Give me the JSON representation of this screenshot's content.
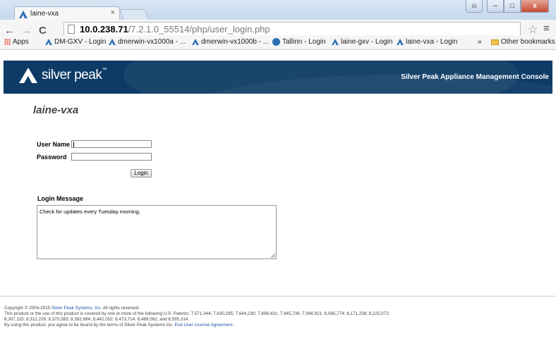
{
  "browser": {
    "tab_title": "laine-vxa",
    "tab_close": "×",
    "url_host": "10.0.238.71",
    "url_path": "/7.2.1.0_55514/php/user_login.php",
    "window_buttons": {
      "user": "⍝",
      "minimize": "–",
      "maximize": "□",
      "close": "x"
    },
    "nav": {
      "back": "←",
      "forward": "→",
      "reload": "C"
    },
    "star": "☆",
    "menu": "≡",
    "bookmarks": [
      {
        "label": "Apps",
        "icon": "apps-grid-icon"
      },
      {
        "label": "DM-GXV - Login",
        "icon": "silverpeak-icon"
      },
      {
        "label": "dmerwin-vx1000a - ...",
        "icon": "silverpeak-icon"
      },
      {
        "label": "dmerwin-vx1000b - ...",
        "icon": "silverpeak-icon"
      },
      {
        "label": "Tallinn - Login",
        "icon": "globe-icon"
      },
      {
        "label": "laine-gxv - Login",
        "icon": "silverpeak-icon"
      },
      {
        "label": "laine-vxa - Login",
        "icon": "silverpeak-icon"
      }
    ],
    "overflow": "»",
    "other_bookmarks": "Other bookmarks"
  },
  "header": {
    "logo_text": "silver peak",
    "logo_tm": "™",
    "console_title": "Silver Peak Appliance Management Console"
  },
  "login": {
    "hostname": "laine-vxa",
    "username_label": "User Name",
    "username_value": "",
    "password_label": "Password",
    "password_value": "",
    "login_button": "Login",
    "message_title": "Login Message",
    "message_text": "Check for updates every Tuesday morning."
  },
  "footer": {
    "copyright_prefix": "Copyright © 2004-2015 ",
    "company_link": "Silver Peak Systems, Inc.",
    "copyright_suffix": " All rights reserved.",
    "patents_line1": "This product or the use of this product is covered by one or more of the following U.S. Patents: 7,571,344; 7,630,295; 7,644,230; 7,698,431; 7,945,736; 7,948,921; 8,095,774; 8,171,238; 8,225,072;",
    "patents_line2": "8,307,115; 8,312,226; 8,370,583; 8,392,684; 8,442,052; 8,473,714; 8,489,562; and 8,595,314.",
    "eula_prefix": "By using this product, you agree to be bound by the terms of Silver Peak Systems Inc. ",
    "eula_link": "End User License Agreement",
    "eula_suffix": "."
  }
}
